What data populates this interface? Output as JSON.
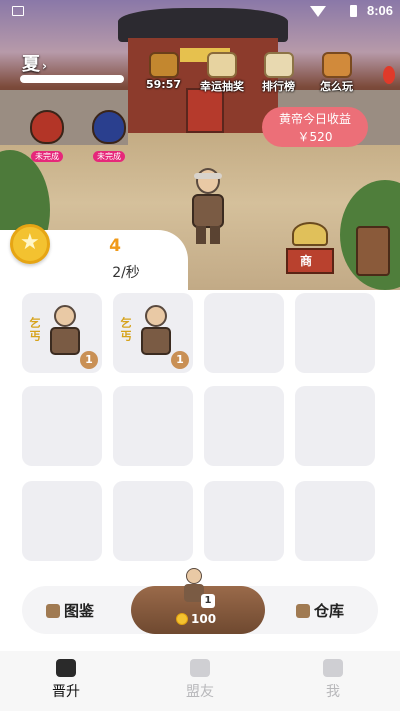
{
  "status_bar": {
    "time": "8:06"
  },
  "header": {
    "season": "夏",
    "chest_timer": "59:57",
    "lottery_label": "幸运抽奖",
    "rank_label": "排行榜",
    "howto_label": "怎么玩"
  },
  "bags": [
    {
      "tag": "未完成",
      "color": "#b33527"
    },
    {
      "tag": "未完成",
      "color": "#2a3f8e"
    }
  ],
  "income": {
    "title": "黄帝今日收益",
    "amount": "￥520"
  },
  "shop": {
    "sign": "商"
  },
  "stats": {
    "total": "4",
    "rate": "2/秒"
  },
  "grid": {
    "cells": [
      {
        "occupied": true,
        "tag": "乞丐",
        "level": "1"
      },
      {
        "occupied": true,
        "tag": "乞丐",
        "level": "1"
      },
      {
        "occupied": false
      },
      {
        "occupied": false
      },
      {
        "occupied": false
      },
      {
        "occupied": false
      },
      {
        "occupied": false
      },
      {
        "occupied": false
      },
      {
        "occupied": false
      },
      {
        "occupied": false
      },
      {
        "occupied": false
      },
      {
        "occupied": false
      }
    ]
  },
  "action_bar": {
    "left_label": "图鉴",
    "buy_level": "1",
    "buy_cost": "100",
    "right_label": "仓库"
  },
  "nav": {
    "items": [
      {
        "label": "晋升",
        "active": true
      },
      {
        "label": "盟友",
        "active": false
      },
      {
        "label": "我",
        "active": false
      }
    ]
  },
  "colors": {
    "accent_orange": "#f09a1a",
    "income_pink": "#ec6f78",
    "buy_brown": "#7a5238",
    "cell_bg": "#eeeef2"
  }
}
